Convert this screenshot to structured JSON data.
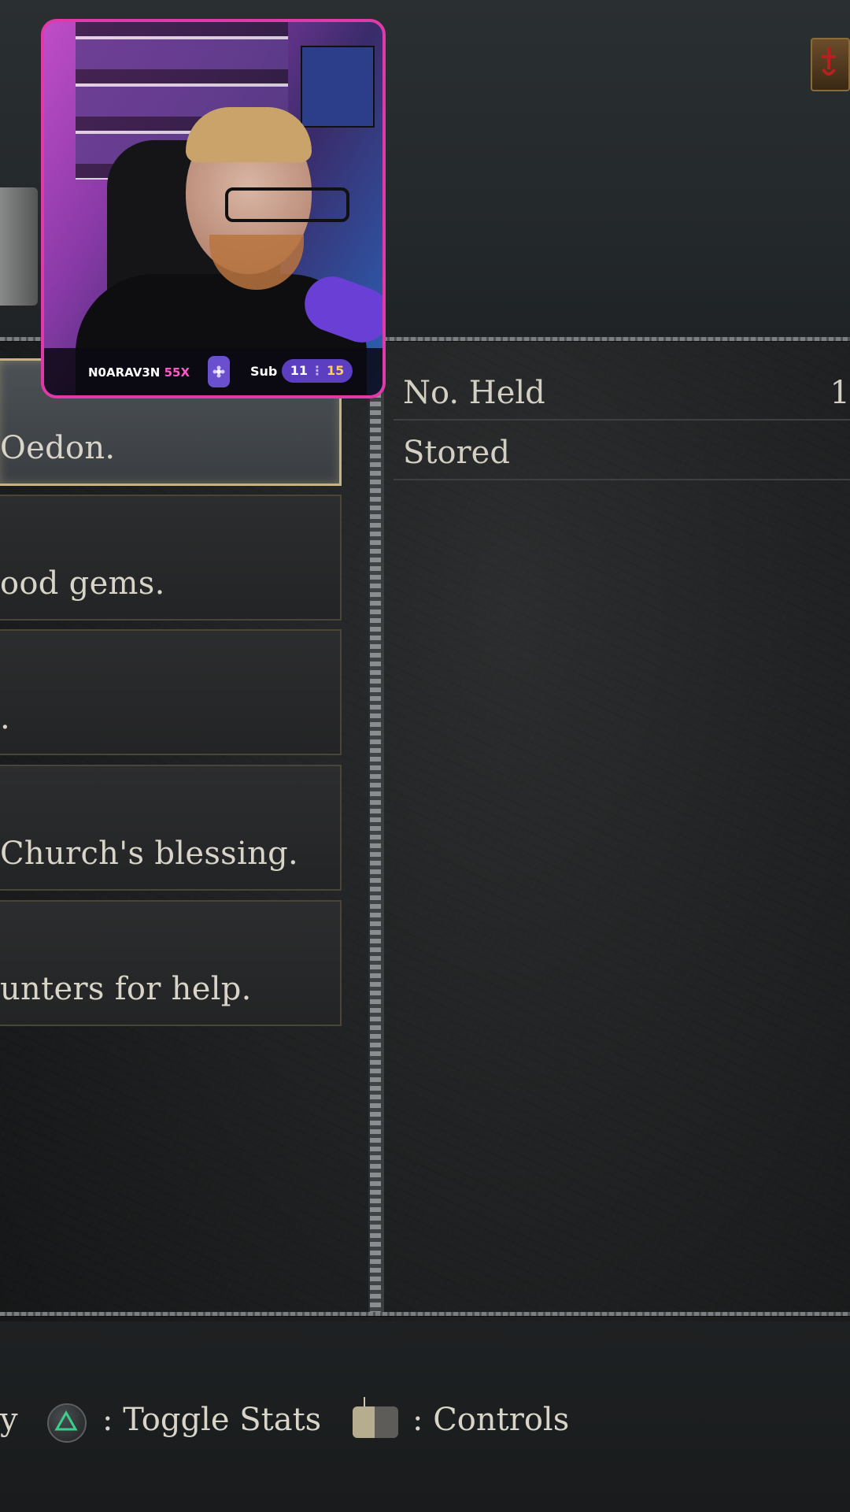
{
  "menu_rows": [
    {
      "text": "Oedon.",
      "selected": true
    },
    {
      "text": "ood gems.",
      "selected": false
    },
    {
      "text": ".",
      "selected": false
    },
    {
      "text": "Church's blessing.",
      "selected": false
    },
    {
      "text": "unters for help.",
      "selected": false
    }
  ],
  "stats": [
    {
      "label": "No. Held",
      "value": "1"
    },
    {
      "label": "Stored",
      "value": ""
    }
  ],
  "hints": {
    "partial": "y",
    "toggle_stats": ": Toggle Stats",
    "controls": ": Controls"
  },
  "webcam": {
    "name": "N0ARAV3N",
    "name_highlight": "55X",
    "sub_label": "Sub",
    "count_a": "11",
    "count_b": "15"
  },
  "colors": {
    "accent_border": "#c8b483",
    "overlay_border": "#e03aa8",
    "pill": "#5b3fc0"
  }
}
